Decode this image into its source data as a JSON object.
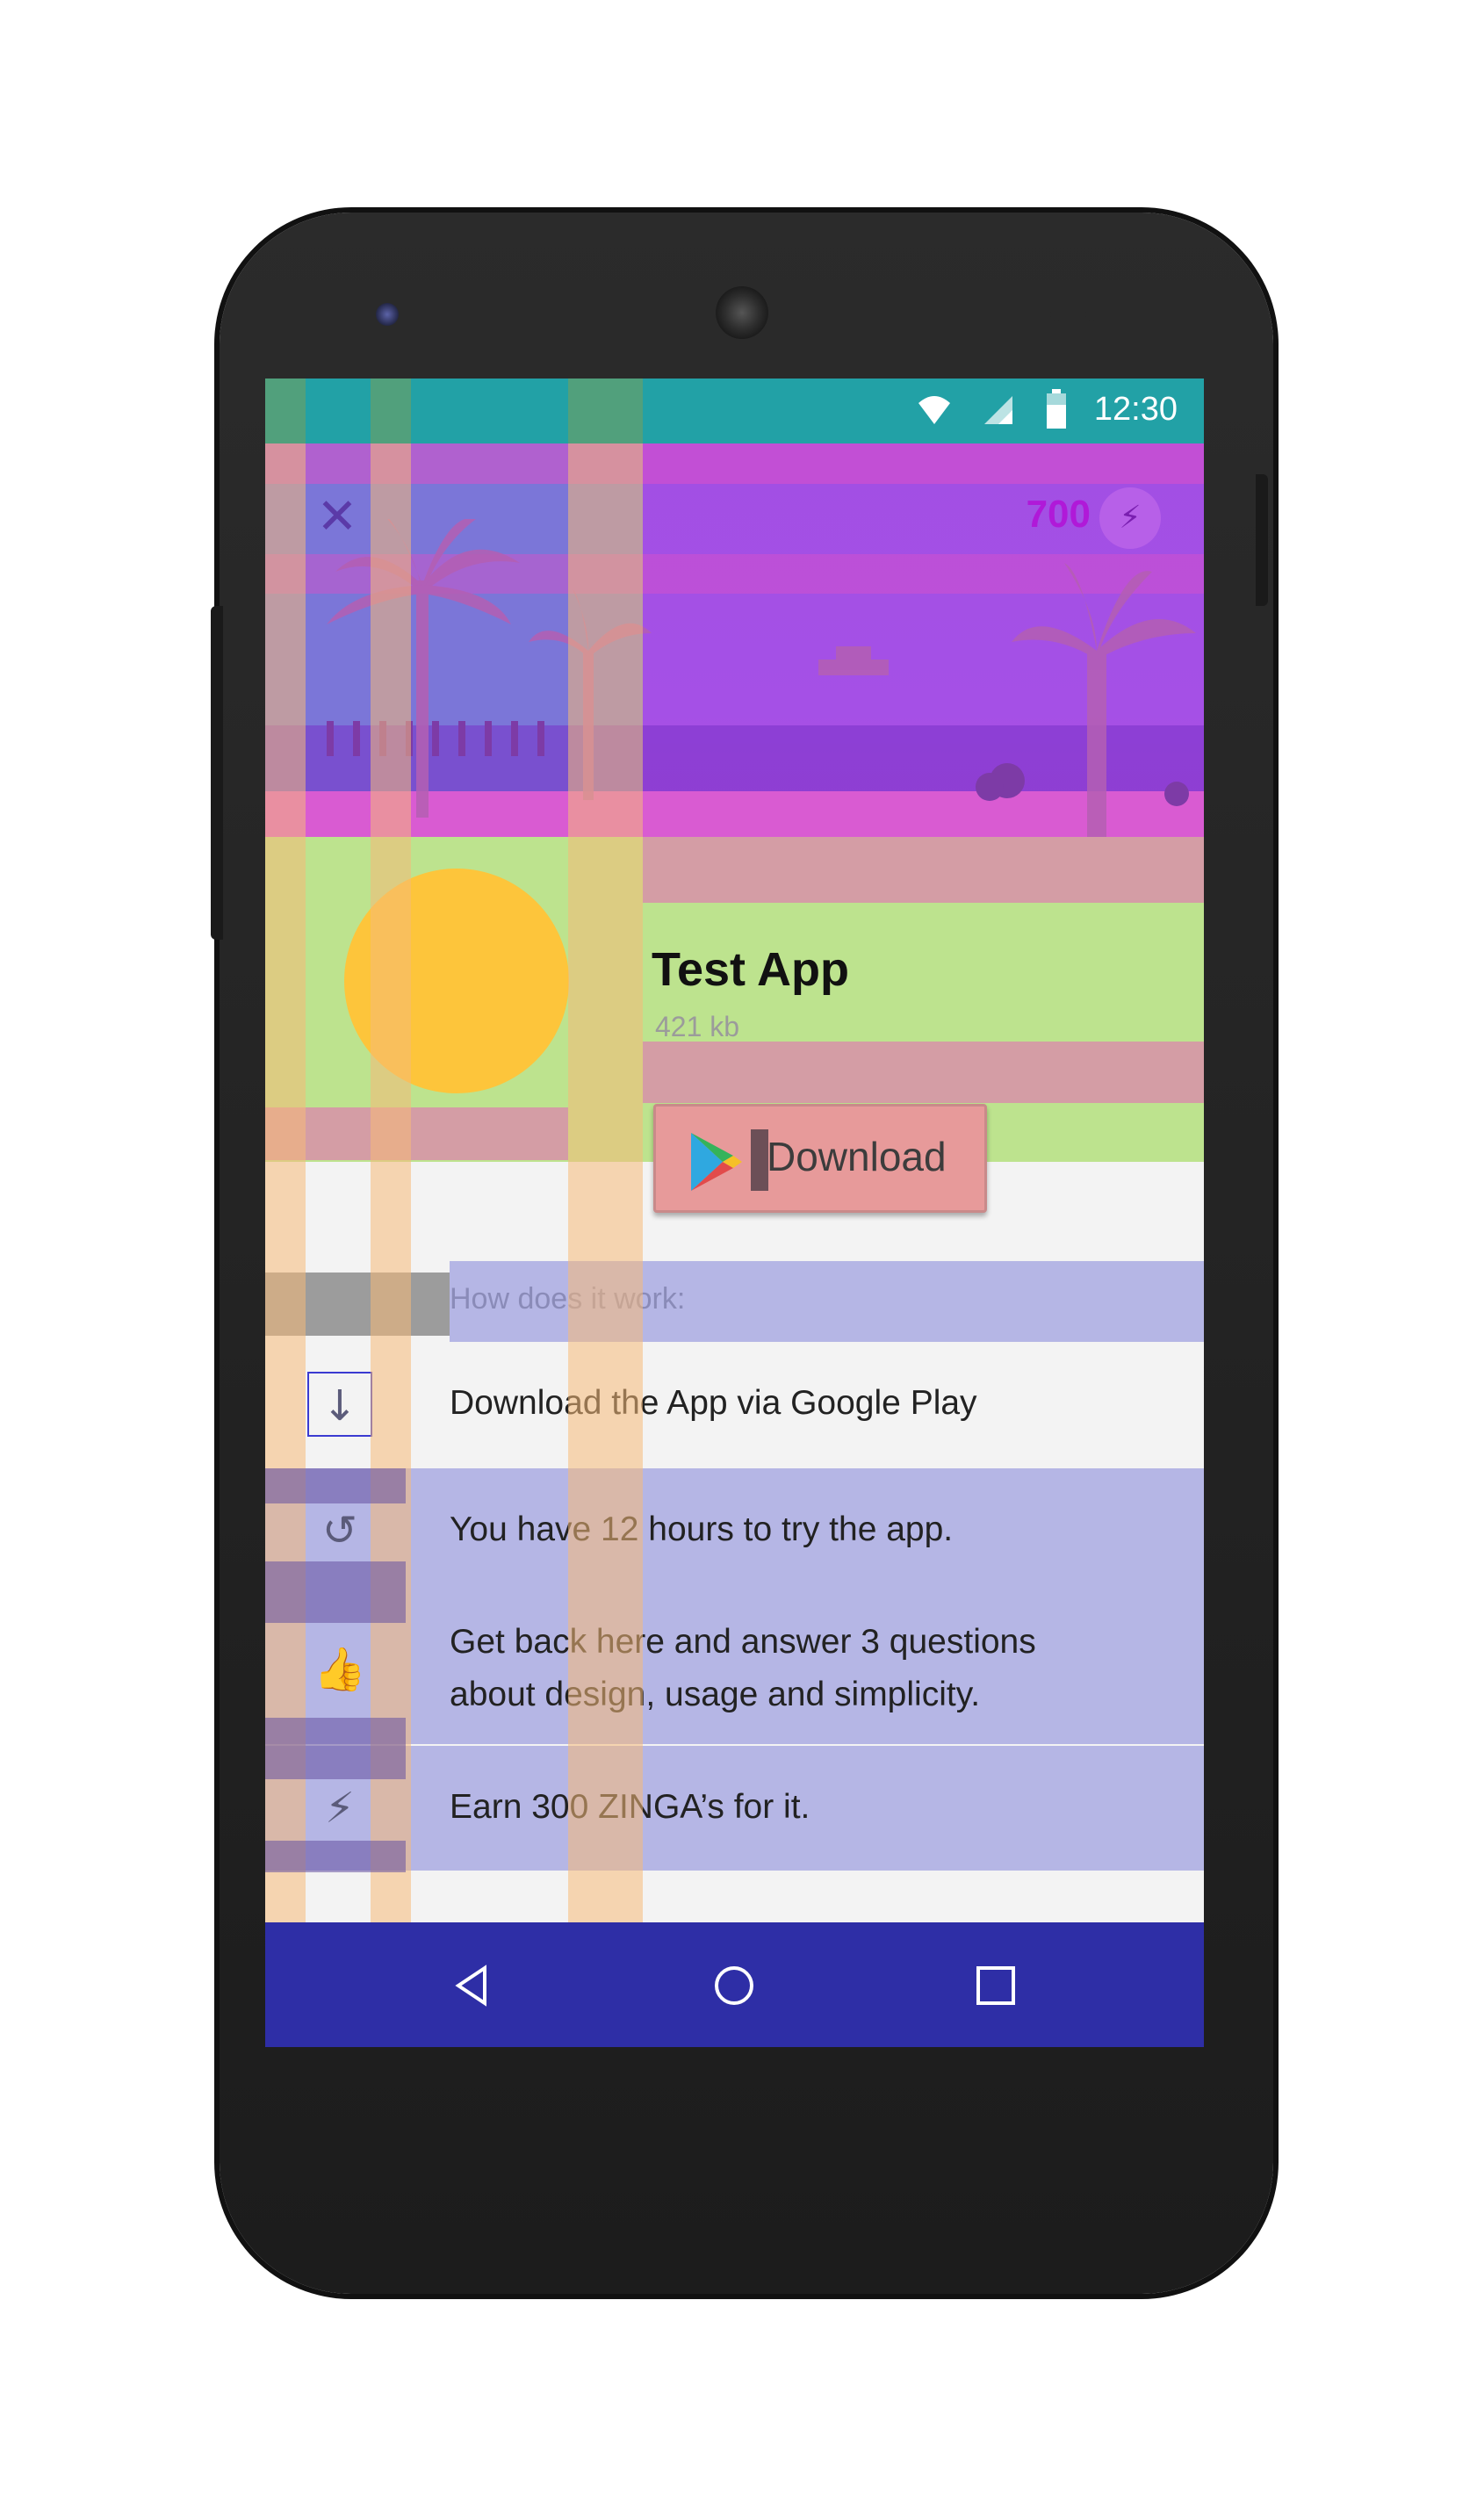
{
  "status_bar": {
    "time": "12:30",
    "icons": [
      "wifi-icon",
      "signal-icon",
      "battery-icon"
    ],
    "color": "#22a1a6"
  },
  "header": {
    "close_icon": "close-icon",
    "close_glyph": "✕",
    "coins": "700",
    "coin_icon": "lightning-icon",
    "coin_glyph": "⚡"
  },
  "app": {
    "title": "Test App",
    "size": "421 kb",
    "download_label": "Download",
    "download_icon": "google-play-icon"
  },
  "how_it_works": {
    "heading": "How does it work:",
    "steps": [
      {
        "icon": "download-arrow-icon",
        "glyph": "↓",
        "lines": [
          "Download the App via Google Play"
        ]
      },
      {
        "icon": "history-icon",
        "glyph": "↺",
        "lines": [
          "You have 12 hours to try the app."
        ]
      },
      {
        "icon": "thumbs-up-down-icon",
        "glyph": "👍",
        "lines": [
          "Get back here and answer 3 questions",
          "about design, usage and simplicity."
        ]
      },
      {
        "icon": "lightning-icon",
        "glyph": "⚡",
        "lines": [
          "Earn 300 ZINGA’s for it."
        ]
      }
    ]
  },
  "nav_bar": {
    "back": "back-icon",
    "home": "home-icon",
    "recents": "recents-icon",
    "color": "#2e2ea6"
  }
}
